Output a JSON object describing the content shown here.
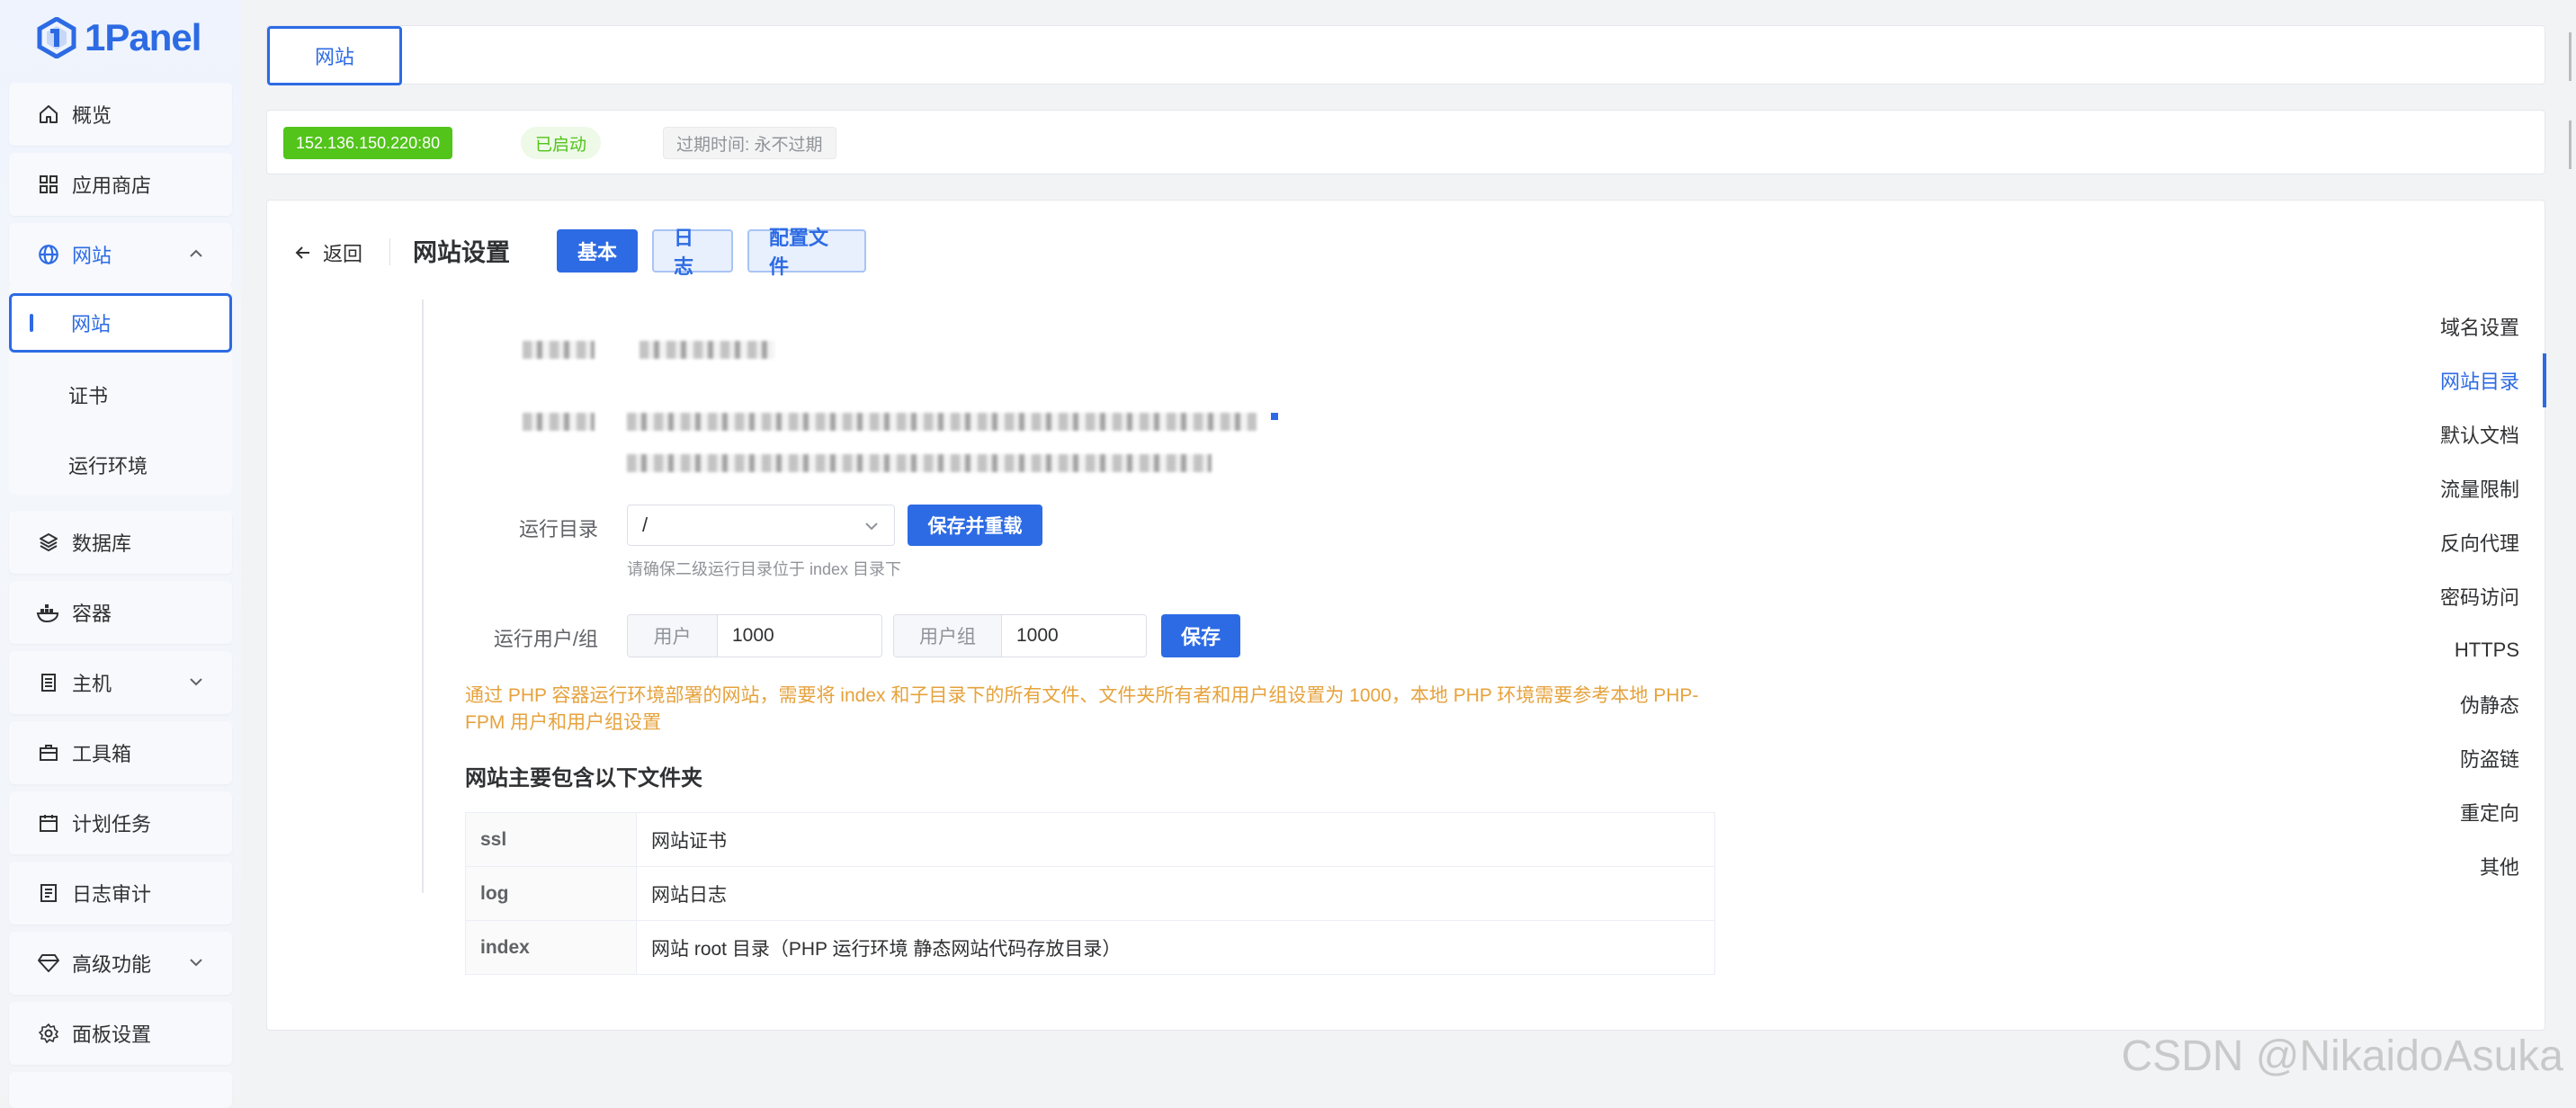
{
  "app": {
    "logo_text": "1Panel"
  },
  "sidebar": {
    "items": [
      {
        "label": "概览",
        "icon": "home-icon"
      },
      {
        "label": "应用商店",
        "icon": "grid-icon"
      },
      {
        "label": "网站",
        "icon": "globe-icon",
        "expanded": true
      },
      {
        "label": "数据库",
        "icon": "layers-icon"
      },
      {
        "label": "容器",
        "icon": "docker-icon"
      },
      {
        "label": "主机",
        "icon": "server-icon"
      },
      {
        "label": "工具箱",
        "icon": "toolbox-icon"
      },
      {
        "label": "计划任务",
        "icon": "calendar-icon"
      },
      {
        "label": "日志审计",
        "icon": "log-icon"
      },
      {
        "label": "高级功能",
        "icon": "diamond-icon"
      },
      {
        "label": "面板设置",
        "icon": "gear-icon"
      }
    ],
    "sub_items": [
      {
        "label": "网站",
        "active": true
      },
      {
        "label": "证书"
      },
      {
        "label": "运行环境"
      }
    ]
  },
  "tabbar": {
    "tab": "网站"
  },
  "info": {
    "ip_port": "152.136.150.220:80",
    "status": "已启动",
    "expire": "过期时间: 永不过期"
  },
  "header": {
    "back": "返回",
    "title": "网站设置",
    "buttons": [
      "基本",
      "日志",
      "配置文件"
    ]
  },
  "submenu": [
    "域名设置",
    "网站目录",
    "默认文档",
    "流量限制",
    "反向代理",
    "密码访问",
    "HTTPS",
    "伪静态",
    "防盗链",
    "重定向",
    "其他"
  ],
  "submenu_active": "网站目录",
  "form": {
    "run_dir_label": "运行目录",
    "run_dir_value": "/",
    "save_reload": "保存并重载",
    "run_dir_hint": "请确保二级运行目录位于 index 目录下",
    "user_group_label": "运行用户/组",
    "user_prefix": "用户",
    "user_value": "1000",
    "group_prefix": "用户组",
    "group_value": "1000",
    "save": "保存"
  },
  "warning": "通过 PHP 容器运行环境部署的网站，需要将 index 和子目录下的所有文件、文件夹所有者和用户组设置为 1000，本地 PHP 环境需要参考本地 PHP-FPM 用户和用户组设置",
  "folders_title": "网站主要包含以下文件夹",
  "folders": [
    {
      "name": "ssl",
      "desc": "网站证书"
    },
    {
      "name": "log",
      "desc": "网站日志"
    },
    {
      "name": "index",
      "desc": "网站 root 目录（PHP 运行环境 静态网站代码存放目录）"
    }
  ],
  "watermark": "CSDN @NikaidoAsuka",
  "colors": {
    "primary": "#2d6be4",
    "success": "#52c41a",
    "warning": "#e6a23c"
  }
}
